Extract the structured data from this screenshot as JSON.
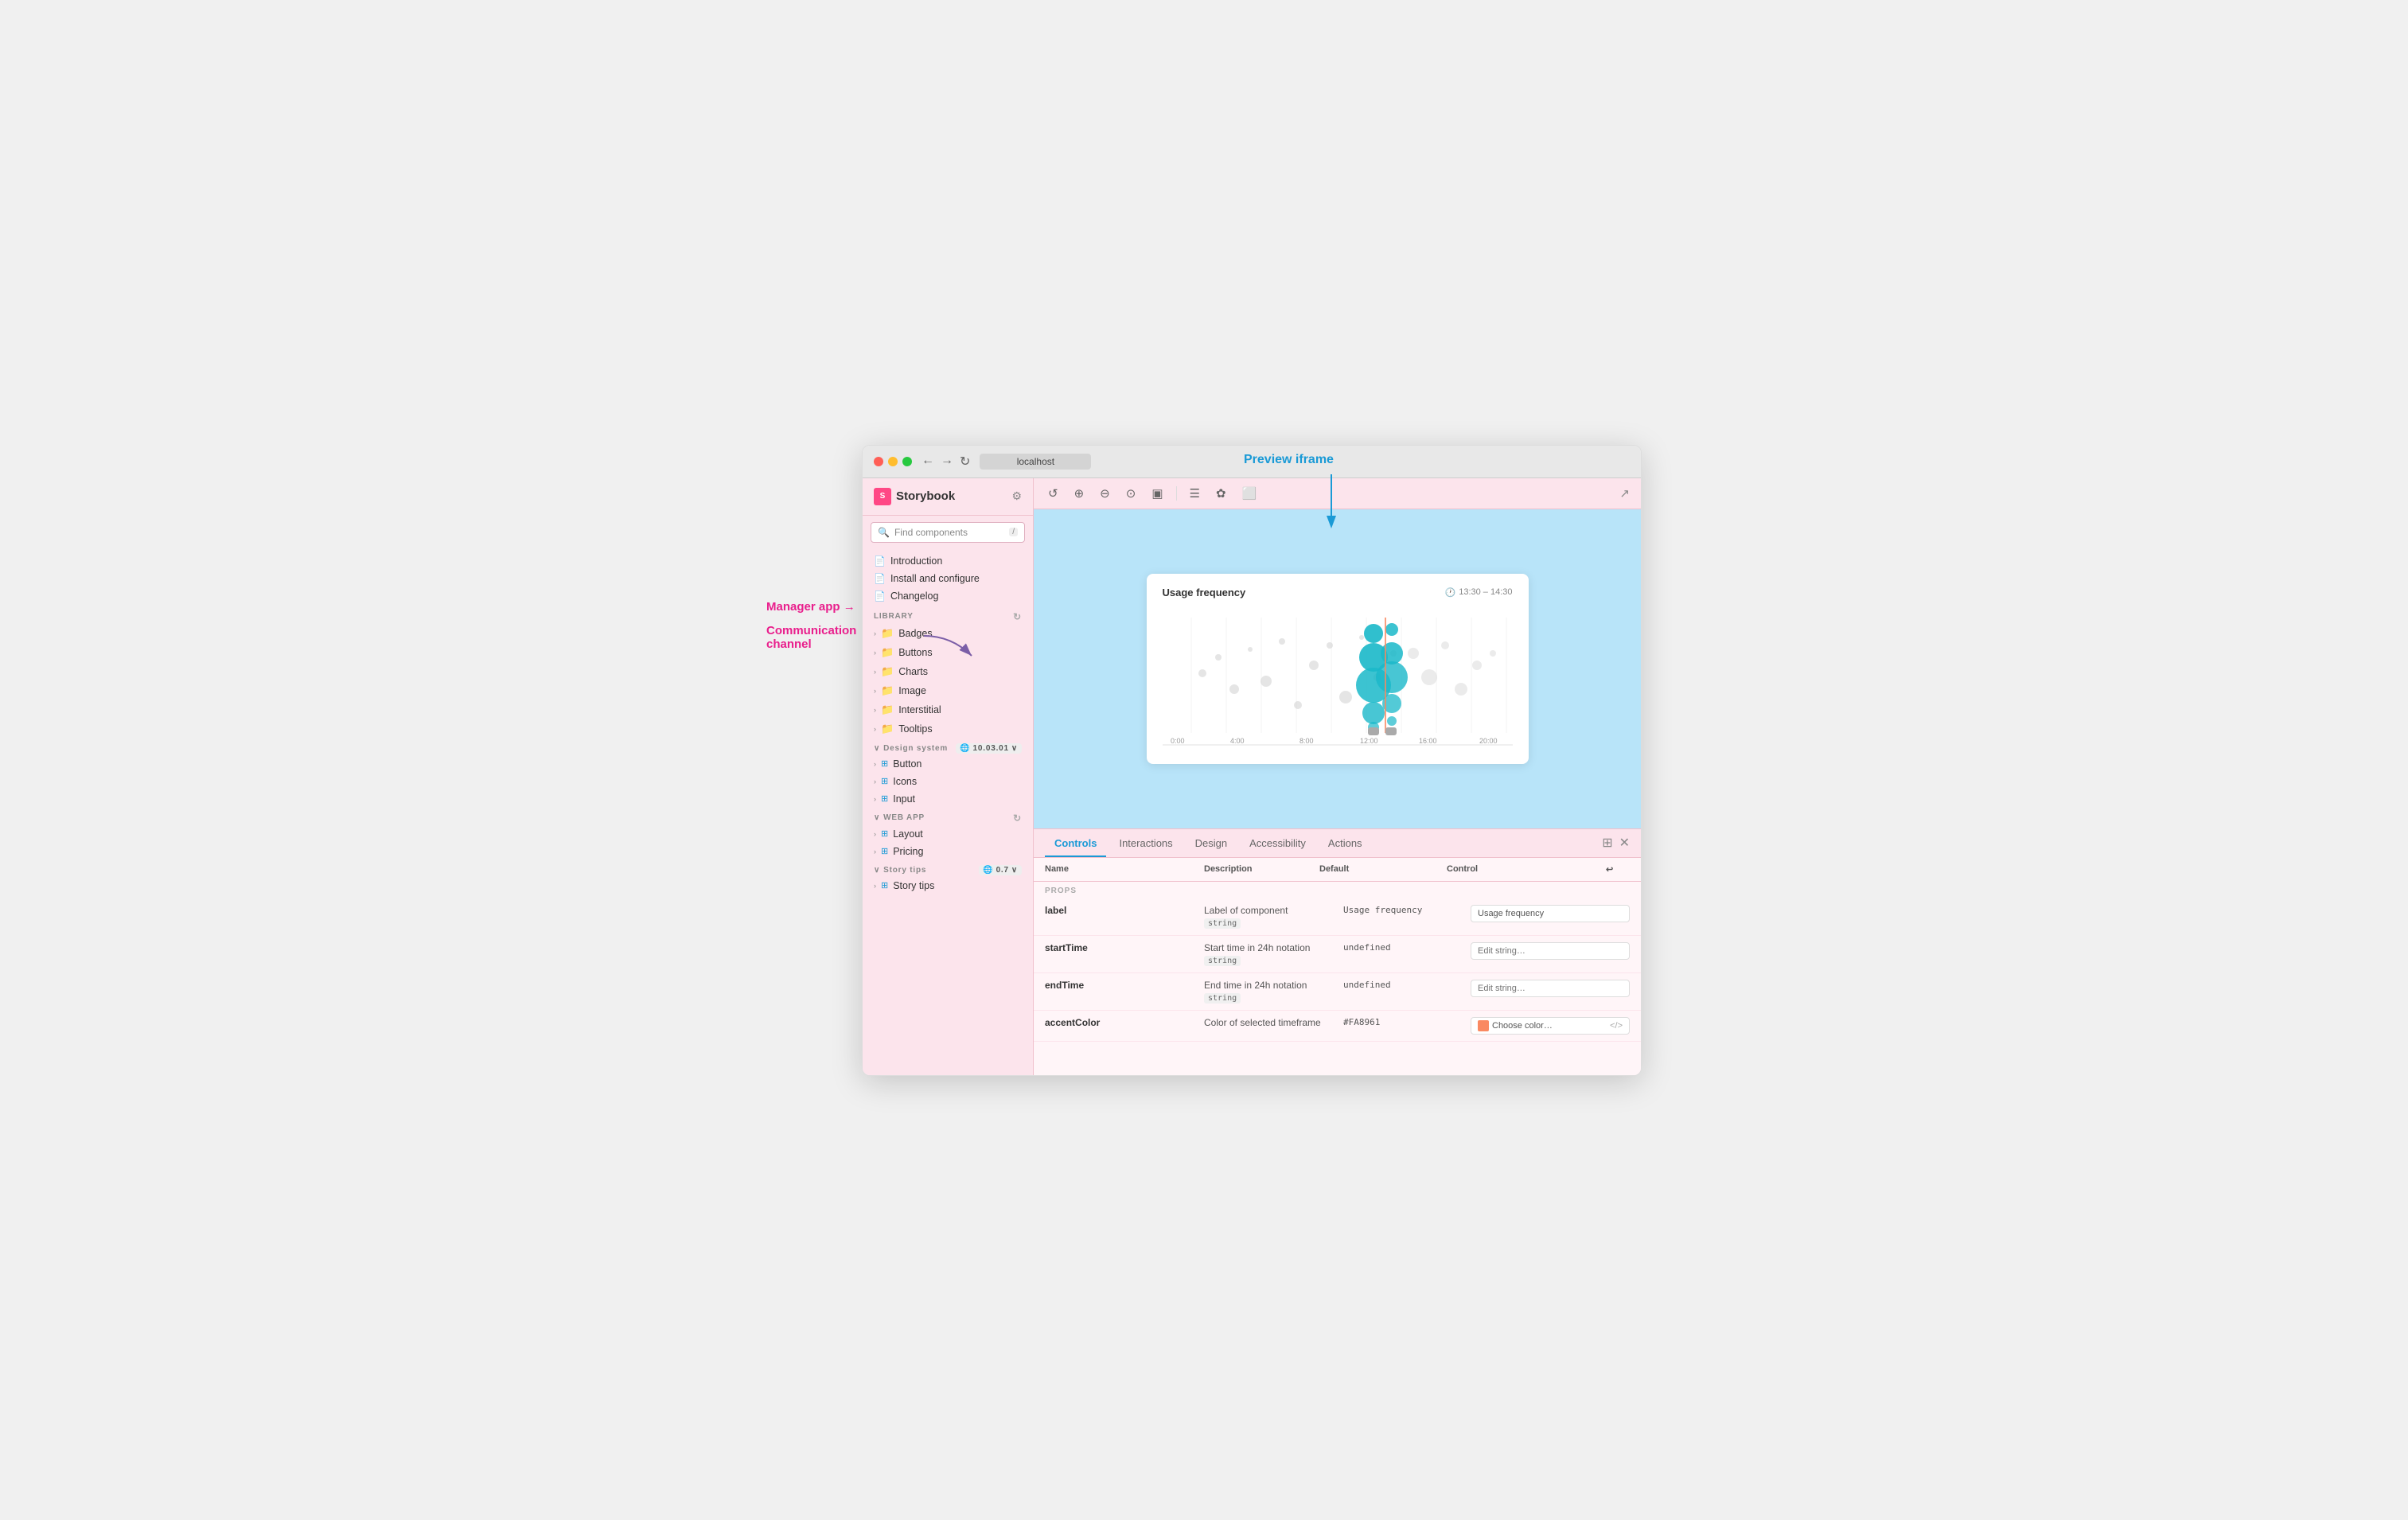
{
  "annotations": {
    "manager_app": "Manager app",
    "manager_arrow": "→",
    "comm_channel": "Communication",
    "comm_channel2": "channel",
    "preview_iframe": "Preview iframe"
  },
  "browser": {
    "url": "localhost",
    "nav": {
      "back": "←",
      "forward": "→",
      "reload": "↻"
    }
  },
  "sidebar": {
    "logo": "Storybook",
    "search_placeholder": "Find components",
    "search_shortcut": "/",
    "stories": [
      {
        "label": "Introduction",
        "type": "doc"
      },
      {
        "label": "Install and configure",
        "type": "doc"
      },
      {
        "label": "Changelog",
        "type": "doc"
      }
    ],
    "library_section": "LIBRARY",
    "library_items": [
      {
        "label": "Badges",
        "type": "folder"
      },
      {
        "label": "Buttons",
        "type": "folder"
      },
      {
        "label": "Charts",
        "type": "folder"
      },
      {
        "label": "Image",
        "type": "folder"
      },
      {
        "label": "Interstitial",
        "type": "folder"
      },
      {
        "label": "Tooltips",
        "type": "folder"
      }
    ],
    "design_system_section": "Design system",
    "design_system_version": "10.03.01",
    "design_system_items": [
      {
        "label": "Button",
        "type": "component"
      },
      {
        "label": "Icons",
        "type": "component"
      },
      {
        "label": "Input",
        "type": "component"
      }
    ],
    "web_app_section": "WEB APP",
    "web_app_items": [
      {
        "label": "Layout",
        "type": "component"
      },
      {
        "label": "Pricing",
        "type": "component"
      }
    ],
    "story_tips_section": "Story tips",
    "story_tips_version": "0.7",
    "story_tips_items": [
      {
        "label": "Story tips",
        "type": "component"
      }
    ]
  },
  "toolbar": {
    "buttons": [
      "↺",
      "⊕",
      "⊖",
      "⊙",
      "▣",
      "☰",
      "✿",
      "⬜"
    ],
    "external_link": "↗"
  },
  "chart": {
    "title": "Usage frequency",
    "time_icon": "🕐",
    "time_range": "13:30 – 14:30",
    "x_labels": [
      "0:00",
      "4:00",
      "8:00",
      "12:00",
      "16:00",
      "20:00"
    ]
  },
  "controls_panel": {
    "tabs": [
      {
        "label": "Controls",
        "active": true
      },
      {
        "label": "Interactions",
        "active": false
      },
      {
        "label": "Design",
        "active": false
      },
      {
        "label": "Accessibility",
        "active": false
      },
      {
        "label": "Actions",
        "active": false
      }
    ],
    "table_headers": {
      "name": "Name",
      "description": "Description",
      "default": "Default",
      "control": "Control",
      "reset_icon": "↩"
    },
    "section_label": "PROPS",
    "rows": [
      {
        "name": "label",
        "description": "Label of component",
        "type": "string",
        "default": "Usage frequency",
        "control_type": "text",
        "control_value": "Usage frequency"
      },
      {
        "name": "startTime",
        "description": "Start time in 24h notation",
        "type": "string",
        "default": "undefined",
        "control_type": "text",
        "control_placeholder": "Edit string…"
      },
      {
        "name": "endTime",
        "description": "End time in 24h notation",
        "type": "string",
        "default": "undefined",
        "control_type": "text",
        "control_placeholder": "Edit string…"
      },
      {
        "name": "accentColor",
        "description": "Color of selected timeframe",
        "type": null,
        "default": "#FA8961",
        "control_type": "color",
        "control_label": "Choose color…"
      }
    ]
  }
}
